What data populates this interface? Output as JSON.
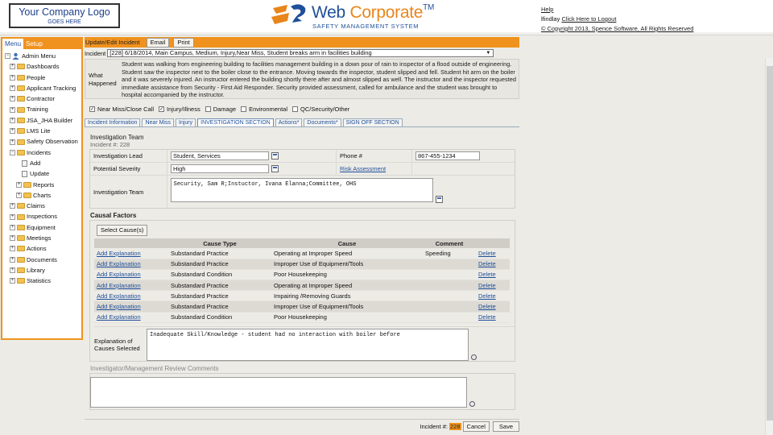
{
  "header": {
    "logo_line1": "Your Company Logo",
    "logo_line2": "GOES HERE",
    "brand_web": "Web",
    "brand_corporate": "Corporate",
    "brand_tm": "TM",
    "brand_tagline": "SAFETY MANAGEMENT SYSTEM",
    "help_link": "Help",
    "username": "lfindlay",
    "logout_link": "Click Here to Logout",
    "copyright": "© Copyright 2013, Spence Software, All Rights Reserved"
  },
  "sidebar": {
    "tab_menu": "Menu",
    "tab_setup": "Setup",
    "root": "Admin Menu",
    "items": [
      {
        "label": "Dashboards",
        "level": 1,
        "type": "folder"
      },
      {
        "label": "People",
        "level": 1,
        "type": "folder"
      },
      {
        "label": "Applicant Tracking",
        "level": 1,
        "type": "folder"
      },
      {
        "label": "Contractor",
        "level": 1,
        "type": "folder"
      },
      {
        "label": "Training",
        "level": 1,
        "type": "folder"
      },
      {
        "label": "JSA_JHA Builder",
        "level": 1,
        "type": "folder"
      },
      {
        "label": "LMS Lite",
        "level": 1,
        "type": "folder"
      },
      {
        "label": "Safety Observation",
        "level": 1,
        "type": "folder"
      },
      {
        "label": "Incidents",
        "level": 1,
        "type": "folder-open"
      },
      {
        "label": "Add",
        "level": 2,
        "type": "page"
      },
      {
        "label": "Update",
        "level": 2,
        "type": "page"
      },
      {
        "label": "Reports",
        "level": 2,
        "type": "folder"
      },
      {
        "label": "Charts",
        "level": 2,
        "type": "folder"
      },
      {
        "label": "Claims",
        "level": 1,
        "type": "folder"
      },
      {
        "label": "Inspections",
        "level": 1,
        "type": "folder"
      },
      {
        "label": "Equipment",
        "level": 1,
        "type": "folder"
      },
      {
        "label": "Meetings",
        "level": 1,
        "type": "folder"
      },
      {
        "label": "Actions",
        "level": 1,
        "type": "folder"
      },
      {
        "label": "Documents",
        "level": 1,
        "type": "folder"
      },
      {
        "label": "Library",
        "level": 1,
        "type": "folder"
      },
      {
        "label": "Statistics",
        "level": 1,
        "type": "folder"
      }
    ]
  },
  "main": {
    "title": "Update/Edit Incident",
    "email_button": "Email",
    "print_button": "Print",
    "incident_label": "Incident",
    "incident_select": "[228] 6/18/2014, Main Campus, Medium, Injury,Near Miss, Student breaks arm in facilities building",
    "what_label": "What Happened",
    "what_text": "Student was walking from engineering building to facilities management building in a down pour of rain to inspector of a flood outside of engineering. Student saw the inspector next to the boiler close to the entrance. Moving towards the inspector, student slipped and fell. Student hit arm on the boiler and it was severely injured. An instructor entered the building shortly there after and almost slipped as well. The instructor and the inspector requested immediate assistance from Security - First Aid Responder. Security provided assessment, called for ambulance and the student was brought to hospital accompanied by the instructor.",
    "checkboxes": [
      {
        "label": "Near Miss/Close Call",
        "checked": true
      },
      {
        "label": "Injury/Illness",
        "checked": true
      },
      {
        "label": "Damage",
        "checked": false
      },
      {
        "label": "Environmental",
        "checked": false
      },
      {
        "label": "QC/Security/Other",
        "checked": false
      }
    ],
    "tabs": [
      {
        "label": "Incident Information",
        "active": false
      },
      {
        "label": "Near Miss",
        "active": false
      },
      {
        "label": "Injury",
        "active": false
      },
      {
        "label": "INVESTIGATION SECTION",
        "active": true
      },
      {
        "label": "Actions*",
        "active": false
      },
      {
        "label": "Documents*",
        "active": false
      },
      {
        "label": "SIGN OFF SECTION",
        "active": false
      }
    ],
    "team": {
      "section_title": "Investigation Team",
      "incident_num": "Incident #: 228",
      "lead_label": "Investigation Lead",
      "lead_value": "Student, Services",
      "phone_label": "Phone #",
      "phone_value": "867-455-1234",
      "severity_label": "Potential Severity",
      "severity_value": "High",
      "risk_link": "Risk Assessment",
      "team_label": "Investigation Team",
      "team_value": "Security, Sam R;Instuctor, Ivana Elanna;Committee, OHS"
    },
    "causal": {
      "section_title": "Causal Factors",
      "select_button": "Select Cause(s)",
      "col_type": "Cause Type",
      "col_cause": "Cause",
      "col_comment": "Comment",
      "add_label": "Add Explanation",
      "delete_label": "Delete",
      "rows": [
        {
          "type": "Substandard Practice",
          "cause": "Operating at Improper Speed",
          "comment": "Speeding"
        },
        {
          "type": "Substandard Practice",
          "cause": "Improper Use of Equipment/Tools",
          "comment": ""
        },
        {
          "type": "Substandard Condition",
          "cause": "Poor Housekeeping",
          "comment": ""
        },
        {
          "type": "Substandard Practice",
          "cause": "Operating at Improper Speed",
          "comment": ""
        },
        {
          "type": "Substandard Practice",
          "cause": "Impairing /Removing Guards",
          "comment": ""
        },
        {
          "type": "Substandard Practice",
          "cause": "Improper Use of Equipment/Tools",
          "comment": ""
        },
        {
          "type": "Substandard Condition",
          "cause": "Poor Housekeeping",
          "comment": ""
        }
      ],
      "expl_label": "Explanation of Causes Selected",
      "expl_value": "Inadequate Skill/Knowledge - student had no interaction with boiler before"
    },
    "review": {
      "section_title": "Investigator/Management Review Comments",
      "value": ""
    }
  },
  "footer": {
    "incident_label": "Incident #:",
    "incident_num": "228",
    "cancel_button": "Cancel",
    "save_button": "Save"
  }
}
